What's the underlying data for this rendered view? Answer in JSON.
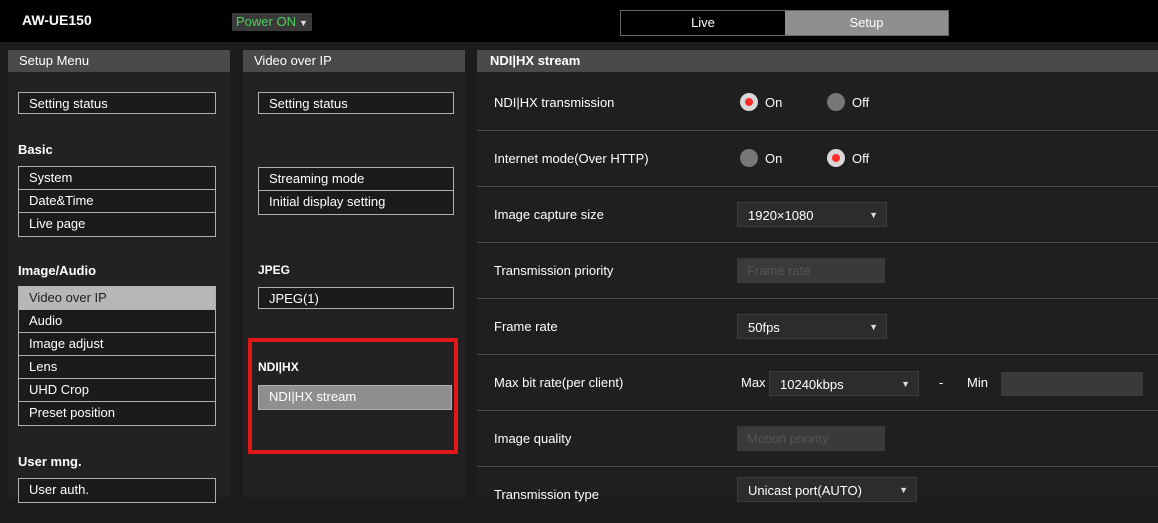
{
  "header": {
    "model": "AW-UE150",
    "power": "Power ON",
    "tabs": {
      "live": "Live",
      "setup": "Setup"
    }
  },
  "menu": {
    "title": "Setup Menu",
    "setting_status": "Setting status",
    "basic": {
      "title": "Basic",
      "items": [
        "System",
        "Date&Time",
        "Live page"
      ]
    },
    "image_audio": {
      "title": "Image/Audio",
      "items": [
        "Video over IP",
        "Audio",
        "Image adjust",
        "Lens",
        "UHD Crop",
        "Preset position"
      ],
      "active": "Video over IP"
    },
    "user": {
      "title": "User mng.",
      "items": [
        "User auth."
      ]
    }
  },
  "submenu": {
    "title": "Video over IP",
    "setting_status": "Setting status",
    "items": [
      "Streaming mode",
      "Initial display setting"
    ],
    "jpeg": {
      "title": "JPEG",
      "item": "JPEG(1)"
    },
    "ndi": {
      "title": "NDI|HX",
      "item": "NDI|HX stream"
    }
  },
  "panel": {
    "title": "NDI|HX stream",
    "on": "On",
    "off": "Off",
    "rows": {
      "transmission": {
        "label": "NDI|HX transmission",
        "selected": "On"
      },
      "internet": {
        "label": "Internet mode(Over HTTP)",
        "selected": "Off"
      },
      "capture": {
        "label": "Image capture size",
        "value": "1920×1080"
      },
      "priority": {
        "label": "Transmission priority",
        "value": "Frame rate"
      },
      "framerate": {
        "label": "Frame rate",
        "value": "50fps"
      },
      "bitrate": {
        "label": "Max bit rate(per client)",
        "max_label": "Max",
        "max_value": "10240kbps",
        "dash": "-",
        "min_label": "Min"
      },
      "quality": {
        "label": "Image quality",
        "value": "Motion priority"
      },
      "type": {
        "label": "Transmission type",
        "value": "Unicast port(AUTO)"
      }
    }
  },
  "colors": {
    "power_green": "#4fd05a",
    "highlight_red": "#e01818",
    "radio_red": "#ff2a2a"
  }
}
